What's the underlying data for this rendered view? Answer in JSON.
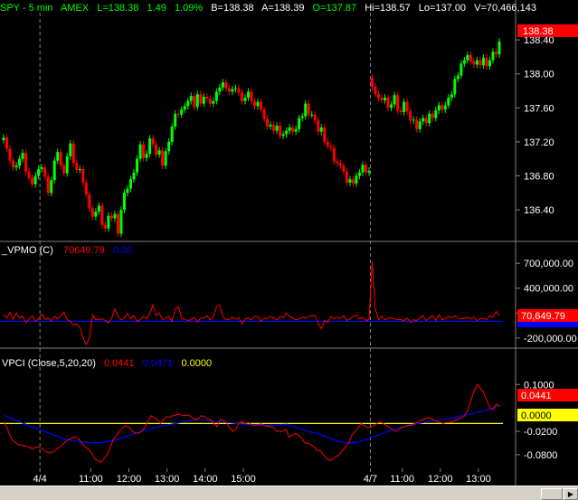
{
  "colors": {
    "background": "#000000",
    "up": "#00ff00",
    "down": "#ff0000",
    "vpmo_line": "#ff0000",
    "blue": "#0000ff",
    "zero_line": "#ffff00",
    "axis_text": "#ffffff",
    "tag_red": "#ff0000",
    "tag_yellow": "#ffff00"
  },
  "header": {
    "symbol": "SPY - 5 min",
    "exchange": "AMEX",
    "last": "L=138.38",
    "change": "1.49",
    "change_pct": "1.09%",
    "bid": "B=138.38",
    "ask": "A=138.39",
    "open": "O=137.87",
    "high": "Hi=138.57",
    "low": "Lo=137.00",
    "volume": "V=70,466,143"
  },
  "vpmo_header": {
    "label": "_VPMO (C)",
    "value1": "70649.79",
    "value2": "0.00"
  },
  "vpci_header": {
    "label": "VPCI (Close,5,20,20)",
    "value1": "0.0441",
    "value2": "0.0471",
    "value3": "0.0000"
  },
  "tags": {
    "price": "138.38",
    "vpmo": "70,649.79",
    "vpci": "0.0441",
    "vpci_zero": "0.0000"
  },
  "chart_data": [
    {
      "type": "candlestick",
      "title": "SPY - 5 min",
      "ylim": [
        136.05,
        138.72
      ],
      "y_ticks": [
        "138.40",
        "138.00",
        "137.60",
        "137.20",
        "136.80",
        "136.40"
      ],
      "x_ticks": [
        "4/4",
        "11:00",
        "12:00",
        "13:00",
        "14:00",
        "15:00",
        "4/7",
        "11:00",
        "12:00",
        "13:00"
      ],
      "day_breaks": [
        "4/4",
        "4/7"
      ],
      "close": [
        137.25,
        137.12,
        136.98,
        136.9,
        136.92,
        137.0,
        137.07,
        136.85,
        136.78,
        136.7,
        136.8,
        136.88,
        136.9,
        136.79,
        136.6,
        136.75,
        136.98,
        137.08,
        136.92,
        136.83,
        137.03,
        137.18,
        136.95,
        136.87,
        136.88,
        136.72,
        136.58,
        136.42,
        136.32,
        136.38,
        136.45,
        136.22,
        136.18,
        136.33,
        136.3,
        136.35,
        136.12,
        136.4,
        136.6,
        136.65,
        136.76,
        136.84,
        137.0,
        137.17,
        137.01,
        137.06,
        137.24,
        137.17,
        137.05,
        137.1,
        136.92,
        137.09,
        137.2,
        137.38,
        137.53,
        137.52,
        137.58,
        137.62,
        137.68,
        137.74,
        137.61,
        137.76,
        137.65,
        137.73,
        137.71,
        137.65,
        137.68,
        137.79,
        137.84,
        137.9,
        137.83,
        137.79,
        137.82,
        137.83,
        137.78,
        137.68,
        137.72,
        137.79,
        137.68,
        137.62,
        137.67,
        137.58,
        137.47,
        137.38,
        137.4,
        137.33,
        137.39,
        137.27,
        137.29,
        137.33,
        137.37,
        137.32,
        137.35,
        137.48,
        137.5,
        137.65,
        137.52,
        137.52,
        137.45,
        137.32,
        137.37,
        137.2,
        137.15,
        137.13,
        136.97,
        136.95,
        136.92,
        136.85,
        136.72,
        136.76,
        136.71,
        136.8,
        136.84,
        136.93,
        136.84,
        136.86,
        137.85,
        137.76,
        137.72,
        137.69,
        137.72,
        137.6,
        137.64,
        137.75,
        137.57,
        137.55,
        137.67,
        137.56,
        137.45,
        137.46,
        137.35,
        137.44,
        137.48,
        137.42,
        137.53,
        137.48,
        137.57,
        137.63,
        137.58,
        137.63,
        137.72,
        137.76,
        137.94,
        137.98,
        138.12,
        138.16,
        138.22,
        138.15,
        138.11,
        138.16,
        138.1,
        138.19,
        138.09,
        138.16,
        138.26,
        138.23,
        138.38
      ]
    },
    {
      "type": "line",
      "title": "_VPMO (C)",
      "ylim": [
        -300000,
        800000
      ],
      "y_ticks": [
        "700,000.00",
        "400,000.00",
        "100,000.00",
        "-200,000.00"
      ],
      "series": [
        {
          "name": "",
          "color": "red",
          "values": [
            80000,
            40000,
            110000,
            25000,
            100000,
            40000,
            60000,
            -15000,
            30000,
            70000,
            0,
            30000,
            90000,
            20000,
            40000,
            5000,
            60000,
            30000,
            70000,
            110000,
            20000,
            0,
            -50000,
            -30000,
            -70000,
            -200000,
            -280000,
            -200000,
            80000,
            20000,
            20000,
            30000,
            10000,
            -20000,
            40000,
            150000,
            60000,
            20000,
            40000,
            100000,
            30000,
            70000,
            0,
            20000,
            60000,
            30000,
            90000,
            200000,
            70000,
            100000,
            20000,
            40000,
            60000,
            0,
            150000,
            180000,
            40000,
            30000,
            10000,
            20000,
            50000,
            -10000,
            40000,
            40000,
            70000,
            20000,
            50000,
            180000,
            200000,
            60000,
            20000,
            20000,
            50000,
            30000,
            40000,
            -30000,
            30000,
            40000,
            20000,
            60000,
            60000,
            0,
            40000,
            30000,
            60000,
            40000,
            20000,
            60000,
            40000,
            100000,
            60000,
            40000,
            20000,
            30000,
            50000,
            40000,
            60000,
            70000,
            70000,
            -20000,
            -90000,
            10000,
            -10000,
            60000,
            30000,
            50000,
            40000,
            70000,
            10000,
            30000,
            60000,
            80000,
            30000,
            50000,
            10000,
            20000,
            720000,
            150000,
            20000,
            60000,
            20000,
            40000,
            40000,
            30000,
            20000,
            20000,
            10000,
            40000,
            -10000,
            20000,
            10000,
            40000,
            70000,
            10000,
            40000,
            70000,
            10000,
            80000,
            20000,
            30000,
            60000,
            40000,
            70000,
            40000,
            30000,
            40000,
            50000,
            30000,
            50000,
            10000,
            30000,
            40000,
            20000,
            70000,
            50000,
            120000,
            70650
          ]
        },
        {
          "name": "",
          "color": "blue",
          "values": [
            0,
            0
          ]
        }
      ]
    },
    {
      "type": "line",
      "title": "VPCI (Close,5,20,20)",
      "ylim": [
        -0.115,
        0.14
      ],
      "y_ticks": [
        "0.1000",
        "-0.0200",
        "-0.0800"
      ],
      "series": [
        {
          "name": "",
          "color": "red",
          "values": [
            0.004,
            -0.01,
            -0.03,
            -0.045,
            -0.05,
            -0.055,
            -0.056,
            -0.058,
            -0.06,
            -0.065,
            -0.062,
            -0.06,
            -0.063,
            -0.07,
            -0.075,
            -0.075,
            -0.072,
            -0.065,
            -0.06,
            -0.052,
            -0.045,
            -0.04,
            -0.036,
            -0.035,
            -0.04,
            -0.052,
            -0.06,
            -0.066,
            -0.075,
            -0.09,
            -0.095,
            -0.1,
            -0.09,
            -0.08,
            -0.06,
            -0.04,
            -0.03,
            -0.02,
            -0.01,
            -0.005,
            -0.01,
            -0.02,
            -0.025,
            -0.025,
            -0.02,
            -0.01,
            0.005,
            0.02,
            0.016,
            0.01,
            0.0,
            0.01,
            0.018,
            0.016,
            0.02,
            0.022,
            0.024,
            0.02,
            0.02,
            0.022,
            0.015,
            0.01,
            0.012,
            0.02,
            0.018,
            0.012,
            0.01,
            -0.0,
            -0.008,
            0.01,
            0.008,
            0.002,
            -0.01,
            -0.02,
            -0.015,
            0.0,
            0.005,
            0.0,
            0.003,
            -0.003,
            -0.005,
            -0.003,
            -0.001,
            -0.004,
            -0.007,
            -0.008,
            -0.01,
            -0.02,
            -0.02,
            -0.02,
            -0.015,
            -0.035,
            -0.03,
            -0.025,
            -0.03,
            -0.038,
            -0.05,
            -0.05,
            -0.055,
            -0.06,
            -0.07,
            -0.07,
            -0.08,
            -0.09,
            -0.095,
            -0.09,
            -0.085,
            -0.08,
            -0.07,
            -0.06,
            -0.05,
            -0.03,
            -0.02,
            -0.01,
            0.0,
            -0.005,
            -0.01,
            -0.01,
            -0.005,
            0.0,
            0.005,
            0.0,
            -0.005,
            -0.01,
            -0.015,
            -0.02,
            -0.015,
            -0.01,
            -0.007,
            -0.005,
            -0.005,
            0.0,
            0.003,
            0.008,
            0.01,
            0.015,
            0.014,
            0.01,
            0.006,
            0.004,
            0.0,
            0.002,
            0.003,
            0.004,
            0.008,
            0.012,
            0.015,
            0.02,
            0.035,
            0.06,
            0.085,
            0.1,
            0.09,
            0.08,
            0.06,
            0.04,
            0.035,
            0.05,
            0.0441
          ]
        },
        {
          "name": "",
          "color": "blue",
          "values": [
            0.022,
            0.01,
            0.0,
            -0.01,
            -0.02,
            -0.03,
            -0.04,
            -0.045,
            -0.048,
            -0.05,
            -0.048,
            -0.042,
            -0.035,
            -0.025,
            -0.018,
            -0.01,
            -0.005,
            0.0,
            0.005,
            0.01,
            0.008,
            0.005,
            0.003,
            0.0,
            -0.002,
            -0.004,
            -0.005,
            -0.004,
            -0.002,
            -0.01,
            -0.02,
            -0.025,
            -0.035,
            -0.045,
            -0.05,
            -0.048,
            -0.04,
            -0.03,
            -0.02,
            -0.012,
            -0.004,
            0.0,
            0.005,
            0.008,
            0.012,
            0.018,
            0.024,
            0.03,
            0.036,
            0.0471
          ]
        },
        {
          "name": "",
          "color": "yellow",
          "values": [
            0,
            0
          ]
        }
      ]
    }
  ]
}
